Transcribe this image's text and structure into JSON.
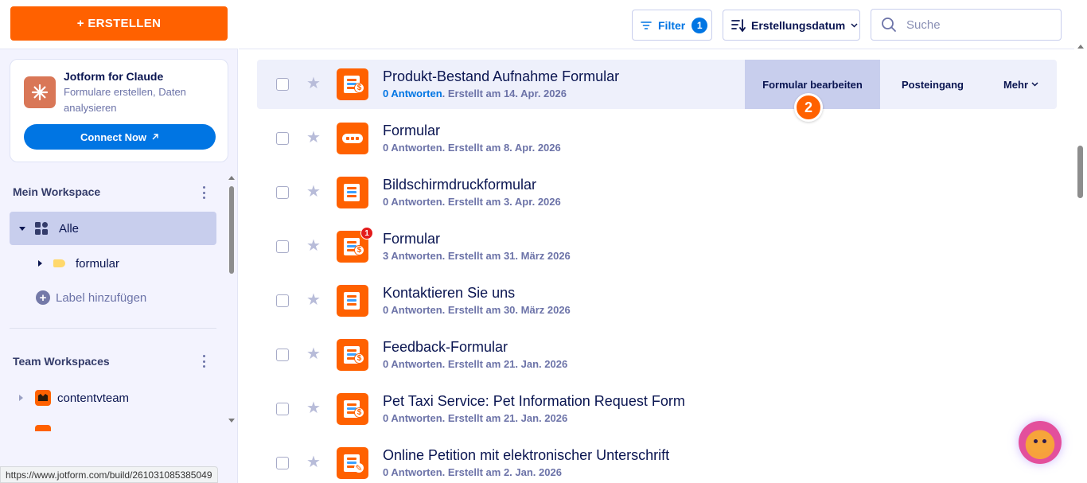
{
  "sidebar": {
    "create_label": "+ ERSTELLEN",
    "promo": {
      "title": "Jotform for Claude",
      "subtitle": "Formulare erstellen, Daten analysieren",
      "cta": "Connect Now"
    },
    "my_workspace": {
      "heading": "Mein Workspace",
      "all_label": "Alle",
      "folder_label": "formular",
      "add_label": "Label hinzufügen"
    },
    "team_workspaces": {
      "heading": "Team Workspaces",
      "items": [
        {
          "label": "contentvteam"
        }
      ]
    }
  },
  "status_url": "https://www.jotform.com/build/261031085385049",
  "topbar": {
    "filter_label": "Filter",
    "filter_count": "1",
    "sort_label": "Erstellungsdatum",
    "search_placeholder": "Suche"
  },
  "forms": [
    {
      "title": "Produkt-Bestand Aufnahme Formular",
      "responses": "0 Antworten",
      "created": ". Erstellt am 14. Apr. 2026",
      "icon": "payment-form-icon"
    },
    {
      "title": "Formular",
      "responses": "0 Antworten",
      "created": ". Erstellt am 8. Apr. 2026",
      "icon": "card-form-icon"
    },
    {
      "title": "Bildschirmdruckformular",
      "responses": "0 Antworten",
      "created": ". Erstellt am 3. Apr. 2026",
      "icon": "form-icon"
    },
    {
      "title": "Formular",
      "responses": "3 Antworten",
      "created": ". Erstellt am 31. März 2026",
      "icon": "payment-form-icon",
      "notification": "1"
    },
    {
      "title": "Kontaktieren Sie uns",
      "responses": "0 Antworten",
      "created": ". Erstellt am 30. März 2026",
      "icon": "form-icon"
    },
    {
      "title": "Feedback-Formular",
      "responses": "0 Antworten",
      "created": ". Erstellt am 21. Jan. 2026",
      "icon": "payment-form-icon"
    },
    {
      "title": "Pet Taxi Service: Pet Information Request Form",
      "responses": "0 Antworten",
      "created": ". Erstellt am 21. Jan. 2026",
      "icon": "payment-form-icon"
    },
    {
      "title": "Online Petition mit elektronischer Unterschrift",
      "responses": "0 Antworten",
      "created": ". Erstellt am 2. Jan. 2026",
      "icon": "signature-form-icon"
    }
  ],
  "row_actions": {
    "edit": "Formular bearbeiten",
    "inbox": "Posteingang",
    "more": "Mehr"
  },
  "step_badge": "2",
  "colors": {
    "brand_orange": "#ff6100",
    "accent_blue": "#0075e3",
    "navy": "#0a1551",
    "sidebar_bg": "#f3f3fe",
    "selected_bg": "#c8ceed"
  }
}
